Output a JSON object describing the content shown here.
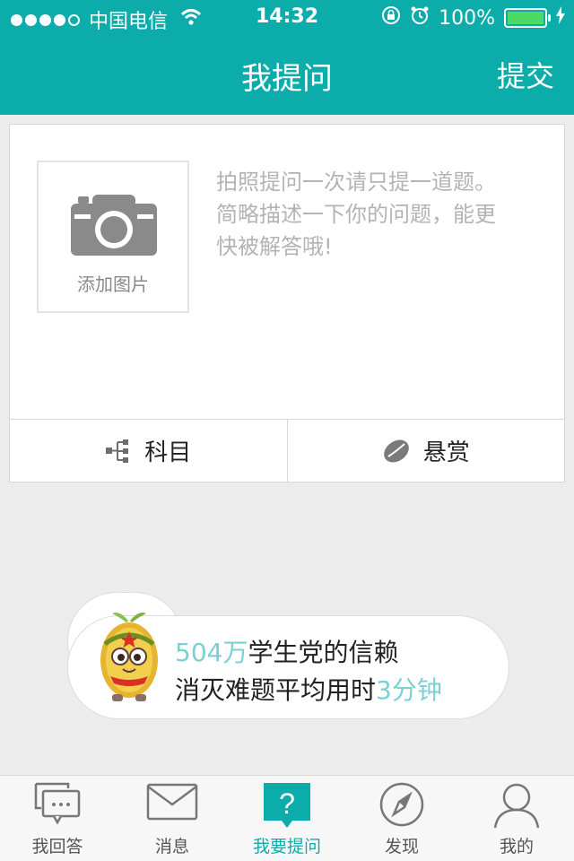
{
  "status_bar": {
    "carrier": "中国电信",
    "time": "14:32",
    "battery": "100%"
  },
  "nav": {
    "title": "我提问",
    "submit_label": "提交"
  },
  "compose": {
    "add_image_label": "添加图片",
    "placeholder": "拍照提问一次请只提一道题。简略描述一下你的问题，能更快被解答哦!"
  },
  "actions": {
    "subject_label": "科目",
    "reward_label": "悬赏"
  },
  "promo": {
    "line1_highlight": "504万",
    "line1_text": "学生党的信赖",
    "line2_text": "消灭难题平均用时",
    "line2_highlight": "3分钟"
  },
  "tabbar": {
    "items": [
      {
        "label": "我回答",
        "icon": "chat-bubbles-icon"
      },
      {
        "label": "消息",
        "icon": "envelope-icon"
      },
      {
        "label": "我要提问",
        "icon": "question-mark-icon",
        "active": true
      },
      {
        "label": "发现",
        "icon": "compass-icon"
      },
      {
        "label": "我的",
        "icon": "person-icon"
      }
    ]
  },
  "colors": {
    "brand": "#0cacab",
    "highlight": "#7ccfd3",
    "battery": "#4cd964"
  }
}
